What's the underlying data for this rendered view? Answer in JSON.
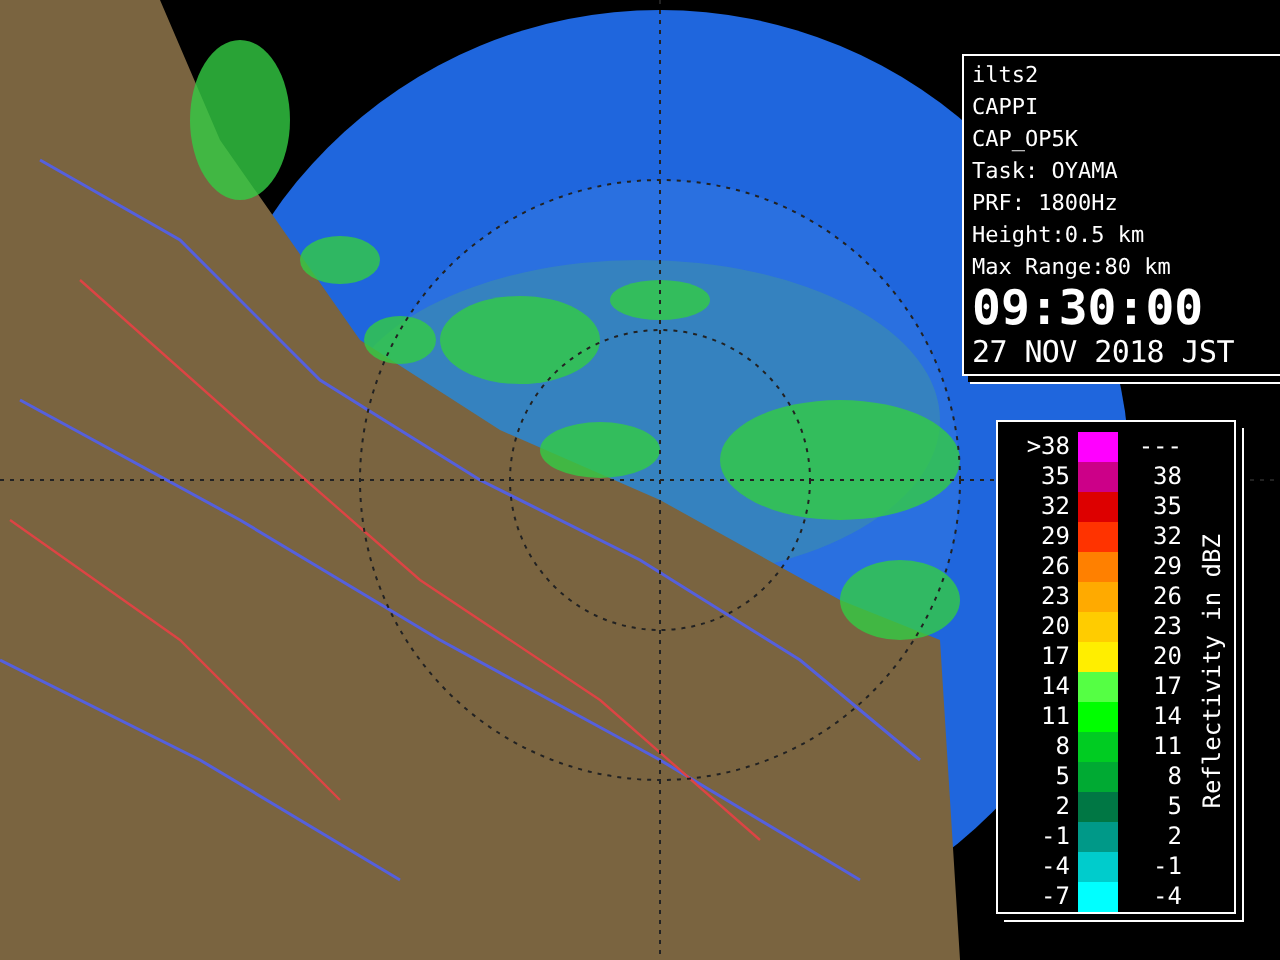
{
  "info_panel": {
    "lines": [
      "ilts2",
      "CAPPI",
      "CAP_OP5K",
      "Task: OYAMA",
      "PRF: 1800Hz",
      "Height:0.5 km",
      "Max Range:80 km"
    ],
    "time": "09:30:00",
    "date": "27 NOV 2018 JST"
  },
  "legend": {
    "title": "Reflectivity in dBZ",
    "rows": [
      {
        "low": ">38",
        "high": "---",
        "color": "#ff00ff"
      },
      {
        "low": "35",
        "high": "38",
        "color": "#cc0088"
      },
      {
        "low": "32",
        "high": "35",
        "color": "#dd0000"
      },
      {
        "low": "29",
        "high": "32",
        "color": "#ff3300"
      },
      {
        "low": "26",
        "high": "29",
        "color": "#ff8000"
      },
      {
        "low": "23",
        "high": "26",
        "color": "#ffaa00"
      },
      {
        "low": "20",
        "high": "23",
        "color": "#ffcc00"
      },
      {
        "low": "17",
        "high": "20",
        "color": "#ffee00"
      },
      {
        "low": "14",
        "high": "17",
        "color": "#55ff44"
      },
      {
        "low": "11",
        "high": "14",
        "color": "#00ff00"
      },
      {
        "low": "8",
        "high": "11",
        "color": "#00cc22"
      },
      {
        "low": "5",
        "high": "8",
        "color": "#00aa33"
      },
      {
        "low": "2",
        "high": "5",
        "color": "#007744"
      },
      {
        "low": "-1",
        "high": "2",
        "color": "#009988"
      },
      {
        "low": "-4",
        "high": "-1",
        "color": "#00cccc"
      },
      {
        "low": "-7",
        "high": "-4",
        "color": "#00ffff"
      }
    ]
  }
}
